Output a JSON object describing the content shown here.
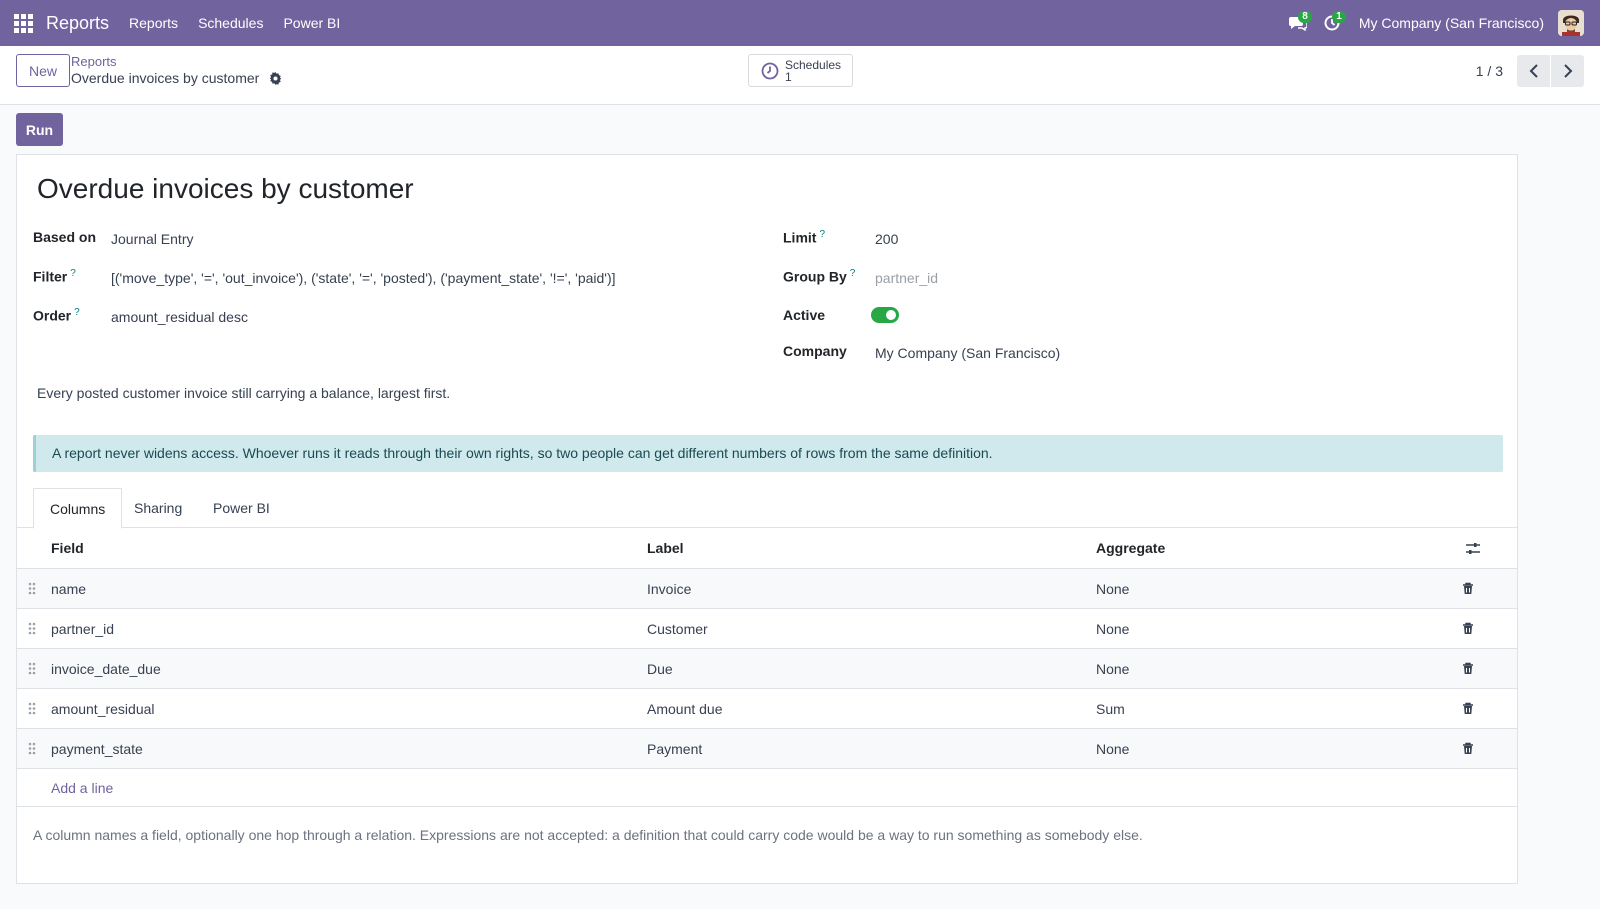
{
  "nav": {
    "brand": "Reports",
    "menu": [
      "Reports",
      "Schedules",
      "Power BI"
    ],
    "messages_count": "8",
    "activities_count": "1",
    "company": "My Company (San Francisco)"
  },
  "control": {
    "new_label": "New",
    "breadcrumb_parent": "Reports",
    "breadcrumb_current": "Overdue invoices by customer",
    "schedules_label": "Schedules",
    "schedules_count": "1",
    "pager": "1 / 3"
  },
  "run_label": "Run",
  "form": {
    "title": "Overdue invoices by customer",
    "based_on_label": "Based on",
    "based_on": "Journal Entry",
    "filter_label": "Filter",
    "filter": "[('move_type', '=', 'out_invoice'), ('state', '=', 'posted'), ('payment_state', '!=', 'paid')]",
    "order_label": "Order",
    "order": "amount_residual desc",
    "limit_label": "Limit",
    "limit": "200",
    "group_by_label": "Group By",
    "group_by_placeholder": "partner_id",
    "active_label": "Active",
    "active": true,
    "company_label": "Company",
    "company": "My Company (San Francisco)",
    "help_mark": "?",
    "description": "Every posted customer invoice still carrying a balance, largest first.",
    "alert": "A report never widens access. Whoever runs it reads through their own rights, so two people can get different numbers of rows from the same definition."
  },
  "tabs": [
    "Columns",
    "Sharing",
    "Power BI"
  ],
  "columns_table": {
    "headers": [
      "Field",
      "Label",
      "Aggregate"
    ],
    "rows": [
      {
        "field": "name",
        "label": "Invoice",
        "aggregate": "None"
      },
      {
        "field": "partner_id",
        "label": "Customer",
        "aggregate": "None"
      },
      {
        "field": "invoice_date_due",
        "label": "Due",
        "aggregate": "None"
      },
      {
        "field": "amount_residual",
        "label": "Amount due",
        "aggregate": "Sum"
      },
      {
        "field": "payment_state",
        "label": "Payment",
        "aggregate": "None"
      }
    ],
    "add_line": "Add a line"
  },
  "help_text": "A column names a field, optionally one hop through a relation. Expressions are not accepted: a definition that could carry code would be a way to run something as somebody else.",
  "colors": {
    "brand": "#71639e",
    "toggle_on": "#28a745",
    "alert_bg": "#cfe9ec"
  }
}
